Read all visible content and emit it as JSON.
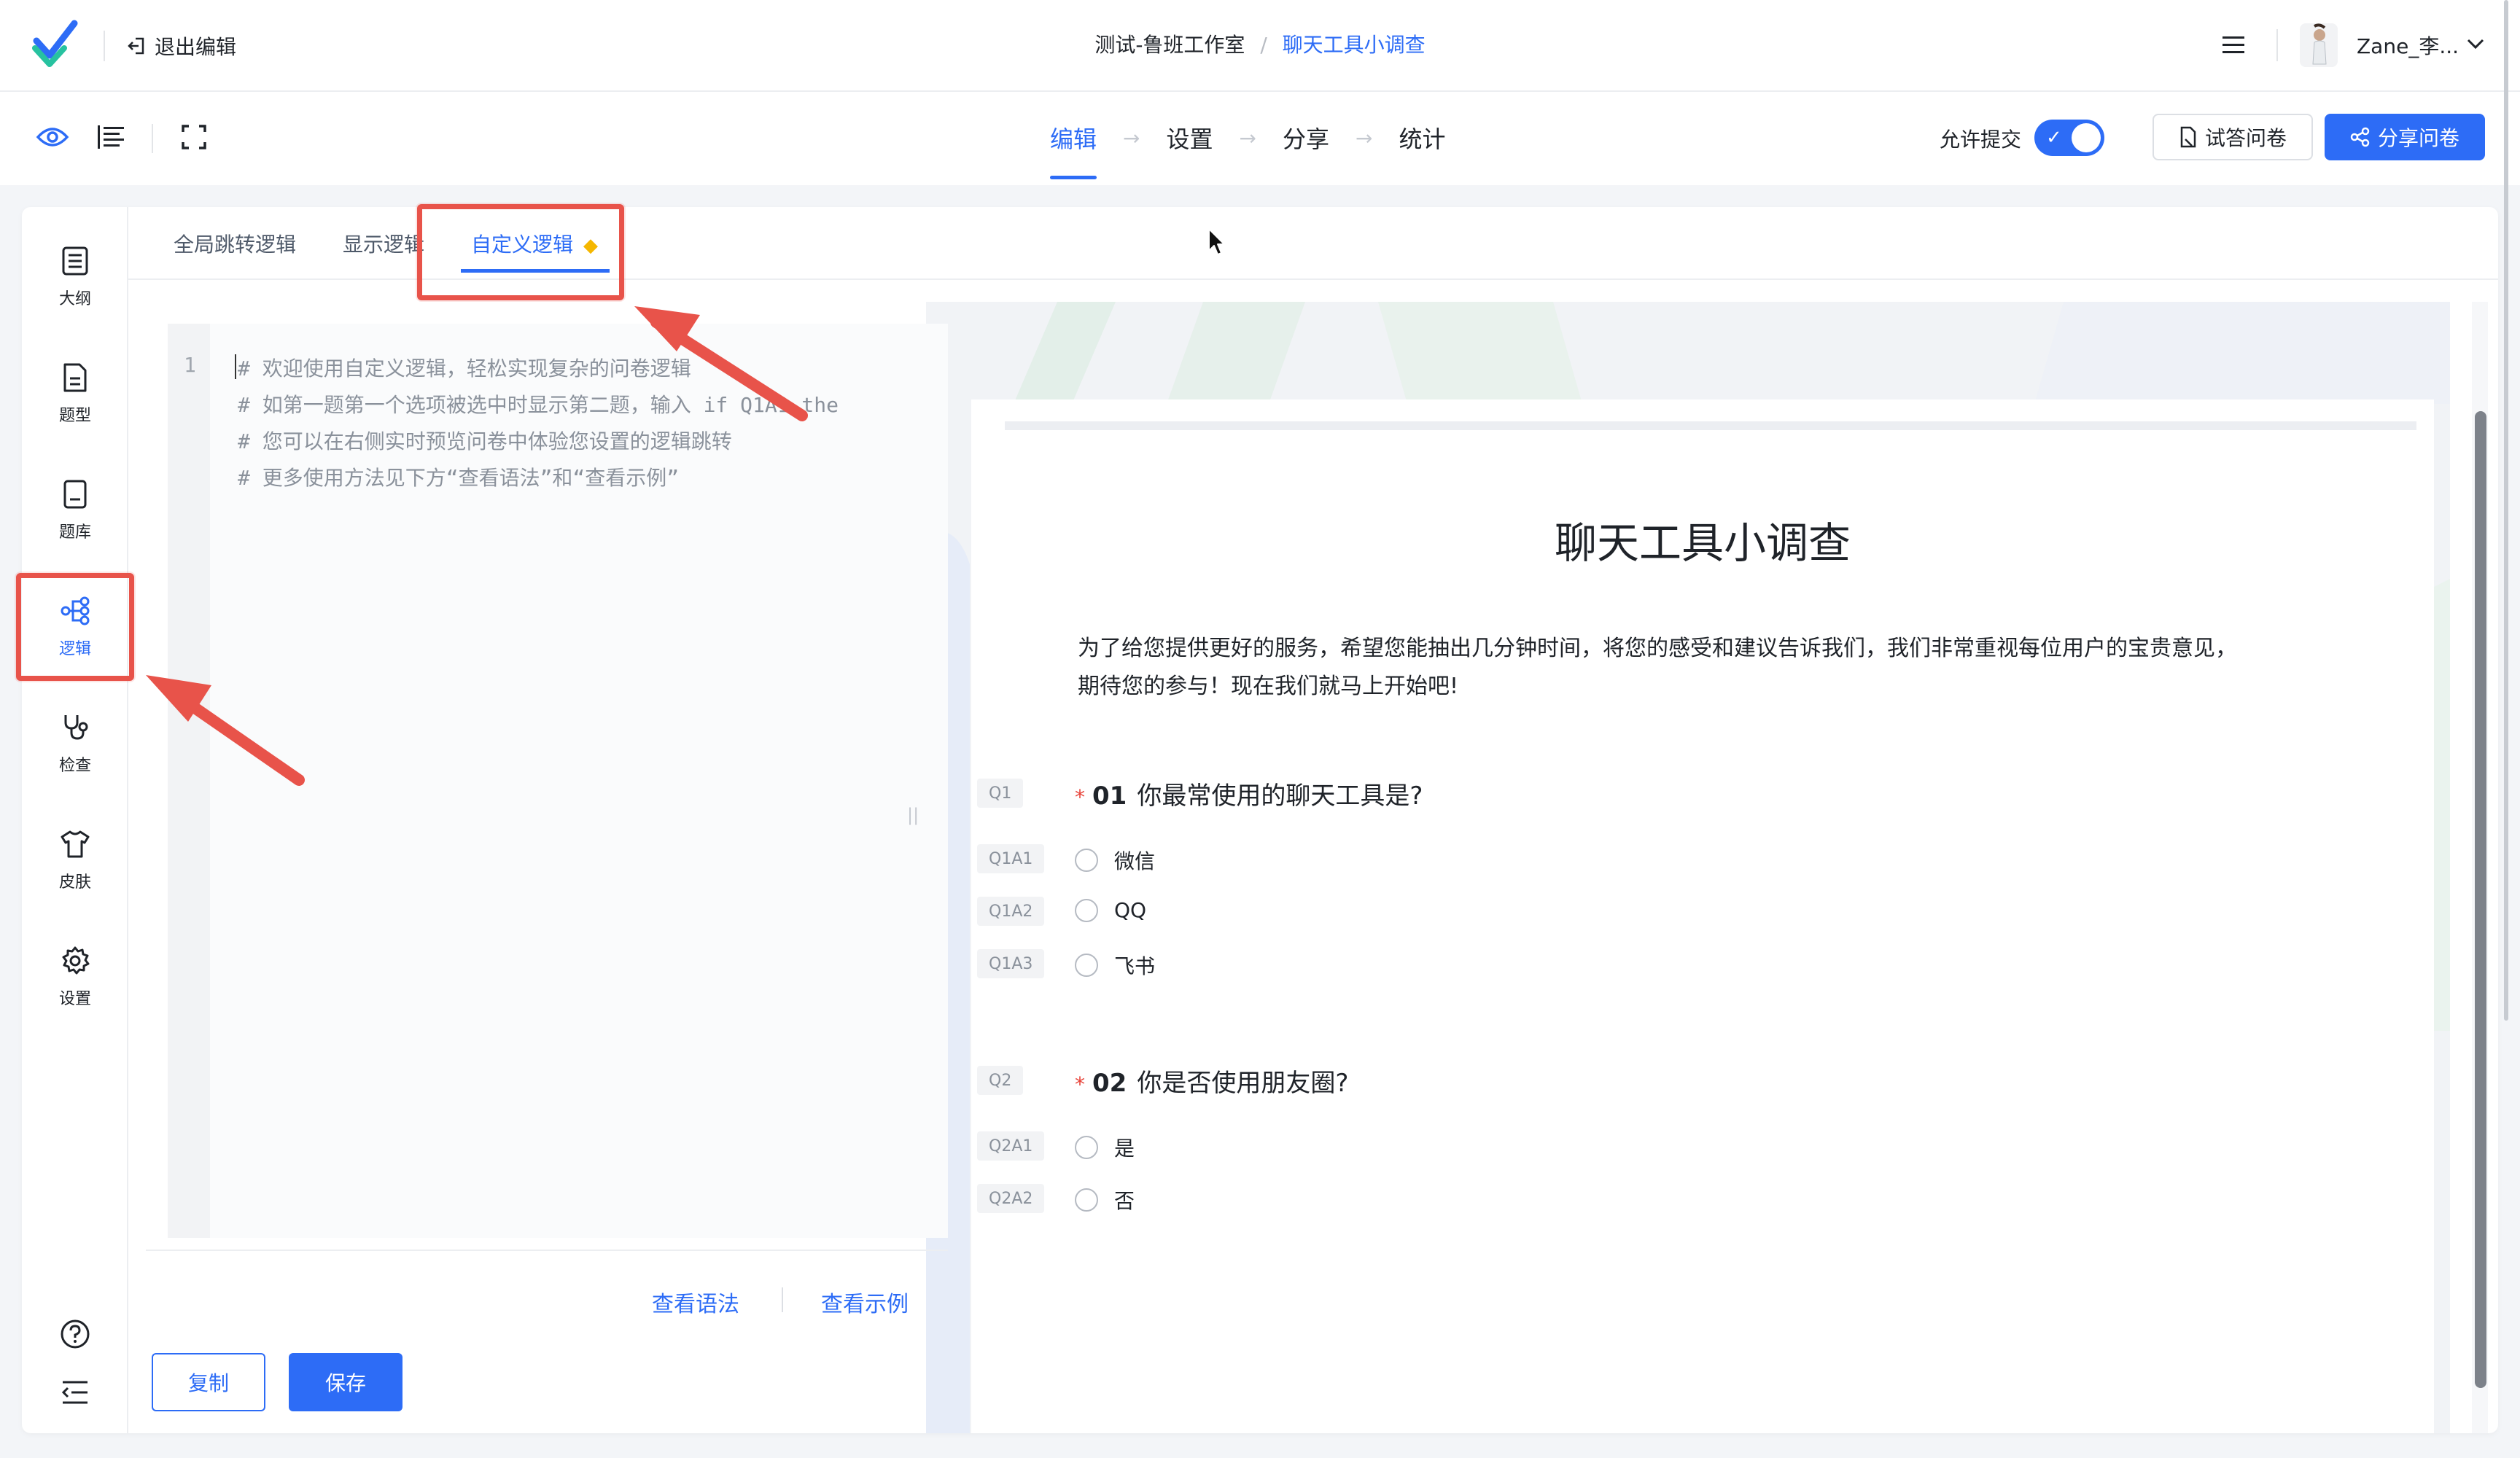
{
  "header": {
    "exit_label": "退出编辑",
    "breadcrumb_workspace": "测试-鲁班工作室",
    "breadcrumb_separator": "/",
    "breadcrumb_survey": "聊天工具小调查",
    "username": "Zane_李..."
  },
  "toolbar": {
    "steps": [
      "编辑",
      "设置",
      "分享",
      "统计"
    ],
    "active_step": "编辑",
    "step_arrow": "→",
    "allow_submit_label": "允许提交",
    "allow_submit_on": true,
    "try_button": "试答问卷",
    "share_button": "分享问卷"
  },
  "sidebar": {
    "items": [
      {
        "label": "大纲",
        "icon": "outline-icon"
      },
      {
        "label": "题型",
        "icon": "question-type-icon"
      },
      {
        "label": "题库",
        "icon": "question-bank-icon"
      },
      {
        "label": "逻辑",
        "icon": "logic-icon",
        "active": true
      },
      {
        "label": "检查",
        "icon": "check-icon"
      },
      {
        "label": "皮肤",
        "icon": "skin-icon"
      },
      {
        "label": "设置",
        "icon": "settings-icon"
      }
    ],
    "bottom_icons": [
      "help-icon",
      "collapse-icon"
    ]
  },
  "logic_tabs": {
    "tabs": [
      "全局跳转逻辑",
      "显示逻辑",
      "自定义逻辑"
    ],
    "active": "自定义逻辑",
    "premium_badge": "diamond-icon"
  },
  "editor": {
    "line_number": "1",
    "lines": [
      "# 欢迎使用自定义逻辑，轻松实现复杂的问卷逻辑",
      "# 如第一题第一个选项被选中时显示第二题，输入 if Q1A1 the",
      "# 您可以在右侧实时预览问卷中体验您设置的逻辑跳转",
      "# 更多使用方法见下方“查看语法”和“查看示例”"
    ],
    "view_syntax": "查看语法",
    "view_examples": "查看示例",
    "copy_button": "复制",
    "save_button": "保存"
  },
  "preview": {
    "title": "聊天工具小调查",
    "description_line1": "为了给您提供更好的服务，希望您能抽出几分钟时间，将您的感受和建议告诉我们，我们非常重视每位用户的宝贵意见，",
    "description_line2": "期待您的参与！现在我们就马上开始吧!",
    "questions": [
      {
        "tag": "Q1",
        "required": "*",
        "number": "01",
        "text": "你最常使用的聊天工具是?",
        "options": [
          {
            "tag": "Q1A1",
            "label": "微信"
          },
          {
            "tag": "Q1A2",
            "label": "QQ"
          },
          {
            "tag": "Q1A3",
            "label": "飞书"
          }
        ]
      },
      {
        "tag": "Q2",
        "required": "*",
        "number": "02",
        "text": "你是否使用朋友圈?",
        "options": [
          {
            "tag": "Q2A1",
            "label": "是"
          },
          {
            "tag": "Q2A2",
            "label": "否"
          }
        ]
      }
    ]
  },
  "colors": {
    "accent": "#2d6cf6",
    "annotation": "#e8534a",
    "required": "#e8443a",
    "premium": "#f5b700"
  }
}
